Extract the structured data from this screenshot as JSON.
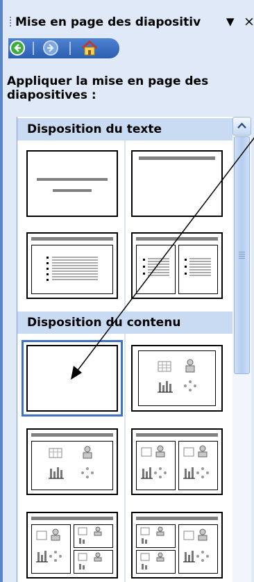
{
  "title": "Mise en page des diapositiv",
  "title_menu_icon": "dropdown-arrow-icon",
  "close_glyph": "×",
  "nav": {
    "back_icon": "back-arrow-icon",
    "forward_icon": "forward-arrow-icon",
    "home_icon": "home-icon"
  },
  "heading": "Appliquer la mise en page des diapositives :",
  "groups": {
    "text_layouts": "Disposition du texte",
    "content_layouts": "Disposition du contenu"
  },
  "colors": {
    "panel_bg": "#dfe9f7",
    "group_header_bg": "#c9dbf3",
    "selection": "#3f72c2"
  }
}
